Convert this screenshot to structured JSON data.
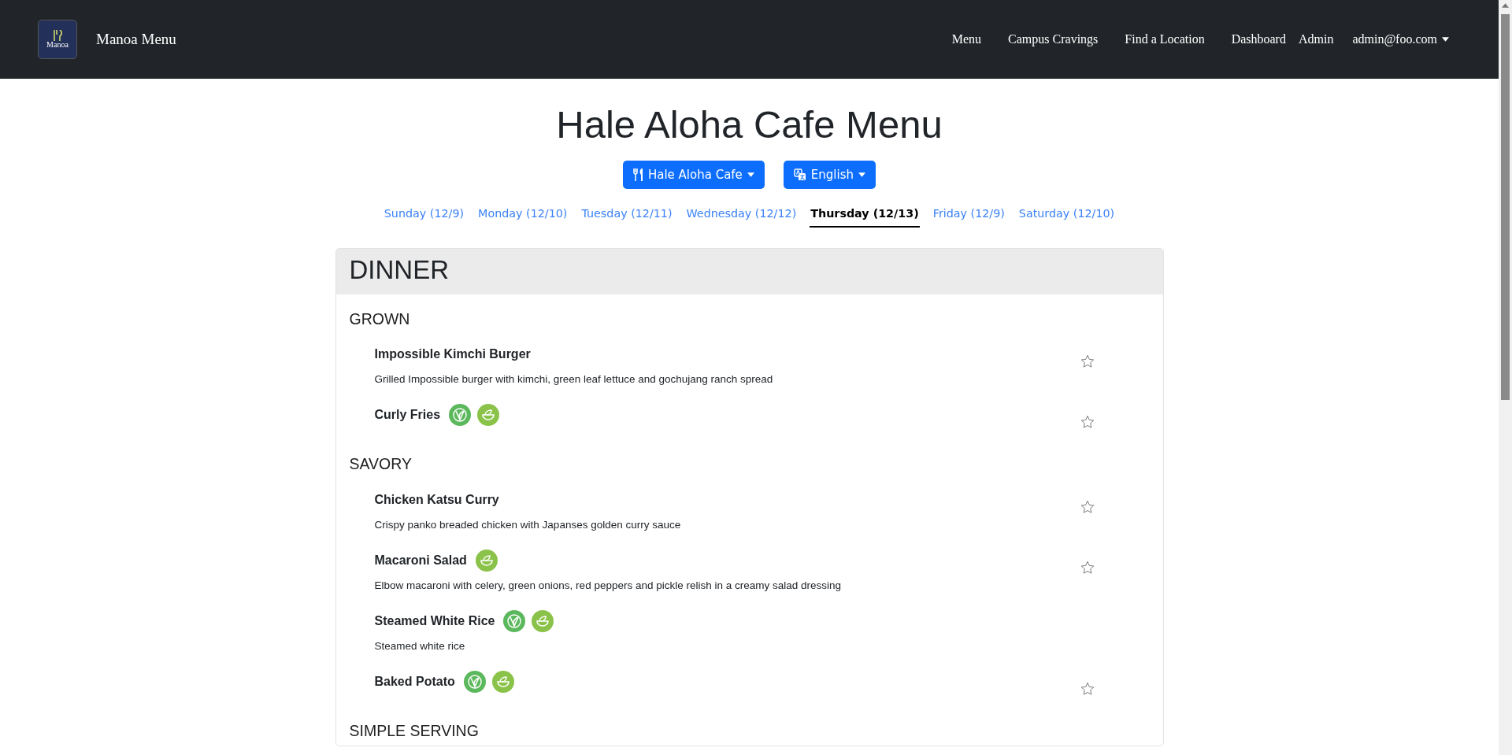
{
  "navbar": {
    "logo_text": "Manoa",
    "brand": "Manoa Menu",
    "links": [
      {
        "label": "Menu",
        "kind": "link"
      },
      {
        "label": "Campus Cravings",
        "kind": "link"
      },
      {
        "label": "Find a Location",
        "kind": "link"
      },
      {
        "label": "Dashboard",
        "kind": "link"
      },
      {
        "label": "Admin",
        "kind": "link"
      },
      {
        "label": "admin@foo.com",
        "kind": "dropdown"
      }
    ]
  },
  "title": "Hale Aloha Cafe Menu",
  "selectors": [
    {
      "label": "Hale Aloha Cafe",
      "kind": "location"
    },
    {
      "label": "English",
      "kind": "language"
    }
  ],
  "days": [
    {
      "label": "Sunday (12/9)",
      "selected": false
    },
    {
      "label": "Monday (12/10)",
      "selected": false
    },
    {
      "label": "Tuesday (12/11)",
      "selected": false
    },
    {
      "label": "Wednesday (12/12)",
      "selected": false
    },
    {
      "label": "Thursday (12/13)",
      "selected": true
    },
    {
      "label": "Friday (12/9)",
      "selected": false
    },
    {
      "label": "Saturday (12/10)",
      "selected": false
    }
  ],
  "meal": {
    "title": "DINNER",
    "categories": [
      {
        "name": "GROWN",
        "items": [
          {
            "name": "Impossible Kimchi Burger",
            "description": "Grilled Impossible burger with kimchi, green leaf lettuce and gochujang ranch spread",
            "starred": false
          },
          {
            "name": "Curly Fries",
            "badges": [
              {
                "kind": "vegan"
              },
              {
                "kind": "vegetarian"
              }
            ],
            "starred": false
          }
        ]
      },
      {
        "name": "SAVORY",
        "items": [
          {
            "name": "Chicken Katsu Curry",
            "description": "Crispy panko breaded chicken with Japanses golden curry sauce",
            "starred": false
          },
          {
            "name": "Macaroni Salad",
            "description": "Elbow macaroni with celery, green onions, red peppers and pickle relish in a creamy salad dressing",
            "badges": [
              {
                "kind": "vegetarian"
              }
            ],
            "starred": false
          },
          {
            "name": "Steamed White Rice",
            "description": "Steamed white rice",
            "badges": [
              {
                "kind": "vegan"
              },
              {
                "kind": "vegetarian"
              }
            ]
          },
          {
            "name": "Baked Potato",
            "badges": [
              {
                "kind": "vegan"
              },
              {
                "kind": "vegetarian"
              }
            ],
            "starred": false
          }
        ]
      },
      {
        "name": "SIMPLE SERVING"
      }
    ]
  }
}
